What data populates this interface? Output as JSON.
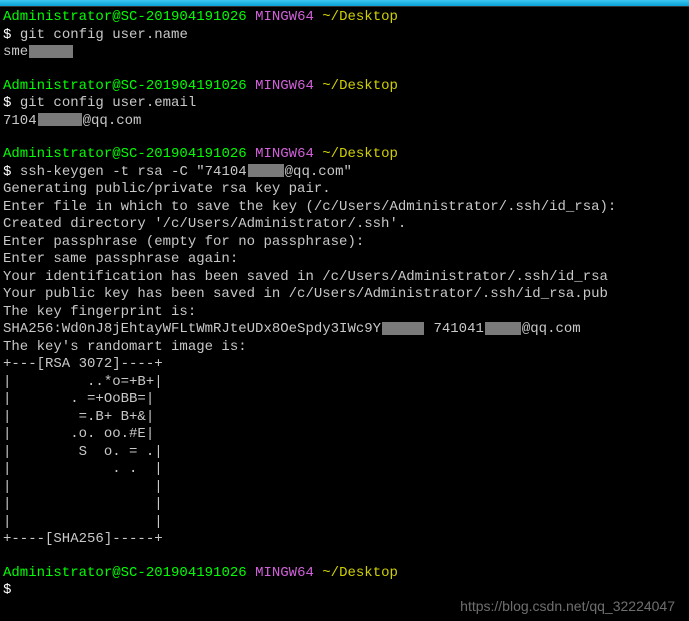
{
  "prompt": {
    "user": "Administrator",
    "host": "SC-201904191026",
    "env": "MINGW64",
    "cwd": "~/Desktop",
    "sym": "$"
  },
  "block1": {
    "cmd": "git config user.name",
    "out_prefix": "sme"
  },
  "block2": {
    "cmd": "git config user.email",
    "out_prefix": "7104",
    "out_suffix": "@qq.com"
  },
  "block3": {
    "cmd_pre": "ssh-keygen -t rsa -C \"74104",
    "cmd_post": "@qq.com\"",
    "l1": "Generating public/private rsa key pair.",
    "l2": "Enter file in which to save the key (/c/Users/Administrator/.ssh/id_rsa):",
    "l3": "Created directory '/c/Users/Administrator/.ssh'.",
    "l4": "Enter passphrase (empty for no passphrase):",
    "l5": "Enter same passphrase again:",
    "l6": "Your identification has been saved in /c/Users/Administrator/.ssh/id_rsa",
    "l7": "Your public key has been saved in /c/Users/Administrator/.ssh/id_rsa.pub",
    "l8": "The key fingerprint is:",
    "fp_pre": "SHA256:Wd0nJ8jEhtayWFLtWmRJteUDx8OeSpdy3IWc9Y",
    "fp_mid": " 741041",
    "fp_post": "@qq.com",
    "l10": "The key's randomart image is:",
    "art": [
      "+---[RSA 3072]----+",
      "|         ..*o=+B+|",
      "|       . =+OoBB=|",
      "|        =.B+ B+&|",
      "|       .o. oo.#E|",
      "|        S  o. = .|",
      "|            . .  |",
      "|                 |",
      "|                 |",
      "|                 |",
      "+----[SHA256]-----+"
    ]
  },
  "watermark": "https://blog.csdn.net/qq_32224047"
}
